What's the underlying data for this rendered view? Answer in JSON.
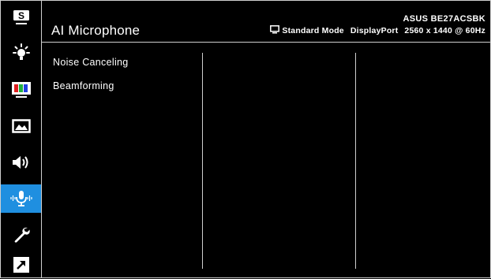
{
  "header": {
    "title": "AI Microphone",
    "model": "ASUS BE27ACSBK",
    "mode": "Standard Mode",
    "input": "DisplayPort",
    "resolution": "2560 x 1440 @ 60Hz",
    "mode_icon": "monitor-icon"
  },
  "sidebar": {
    "items": [
      {
        "icon": "splendid-s-icon"
      },
      {
        "icon": "brightness-icon"
      },
      {
        "icon": "color-bars-icon"
      },
      {
        "icon": "image-icon"
      },
      {
        "icon": "speaker-icon"
      },
      {
        "icon": "ai-microphone-icon",
        "active": true
      },
      {
        "icon": "wrench-icon"
      },
      {
        "icon": "shortcut-arrow-icon"
      }
    ]
  },
  "menu": {
    "items": [
      {
        "label": "Noise Canceling"
      },
      {
        "label": "Beamforming"
      }
    ]
  },
  "colors": {
    "accent": "#1f8fe0",
    "background": "#000000",
    "text": "#ffffff"
  }
}
